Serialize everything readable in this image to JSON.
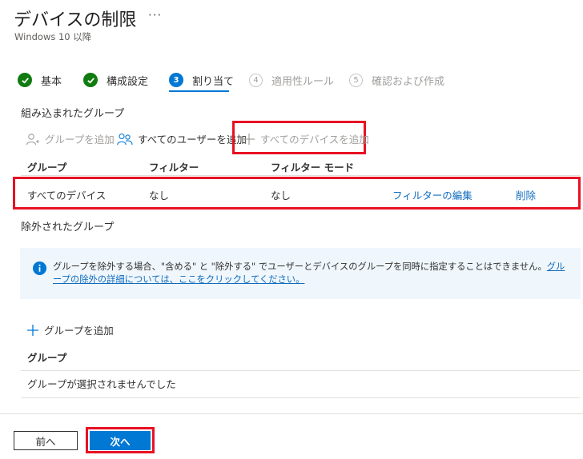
{
  "header": {
    "title": "デバイスの制限",
    "more": "···",
    "subtitle": "Windows 10 以降"
  },
  "steps": [
    {
      "label": "基本",
      "state": "done",
      "icon": "check-icon"
    },
    {
      "label": "構成設定",
      "state": "done",
      "icon": "check-icon"
    },
    {
      "label": "割り当て",
      "state": "current",
      "num": "3"
    },
    {
      "label": "適用性ルール",
      "state": "future",
      "num": "4"
    },
    {
      "label": "確認および作成",
      "state": "future",
      "num": "5"
    }
  ],
  "included": {
    "section_title": "組み込まれたグループ",
    "toolbar": {
      "add_group": "グループを追加",
      "add_all_users": "すべてのユーザーを追加",
      "add_all_devices": "すべてのデバイスを追加"
    },
    "columns": [
      "グループ",
      "フィルター",
      "フィルター モード"
    ],
    "rows": [
      {
        "group": "すべてのデバイス",
        "filter": "なし",
        "filter_mode": "なし",
        "edit_filter": "フィルターの編集",
        "remove": "削除"
      }
    ]
  },
  "excluded": {
    "section_title": "除外されたグループ",
    "info_text": "グループを除外する場合、\"含める\" と \"除外する\" でユーザーとデバイスのグループを同時に指定することはできません。",
    "info_link": "グループの除外の詳細については、ここをクリックしてください。",
    "add_group": "グループを追加",
    "column": "グループ",
    "empty_text": "グループが選択されませんでした"
  },
  "footer": {
    "prev": "前へ",
    "next": "次へ"
  },
  "colors": {
    "accent": "#0078d4",
    "success": "#107c10",
    "highlight": "#e81123",
    "link": "#0f6cbd"
  }
}
